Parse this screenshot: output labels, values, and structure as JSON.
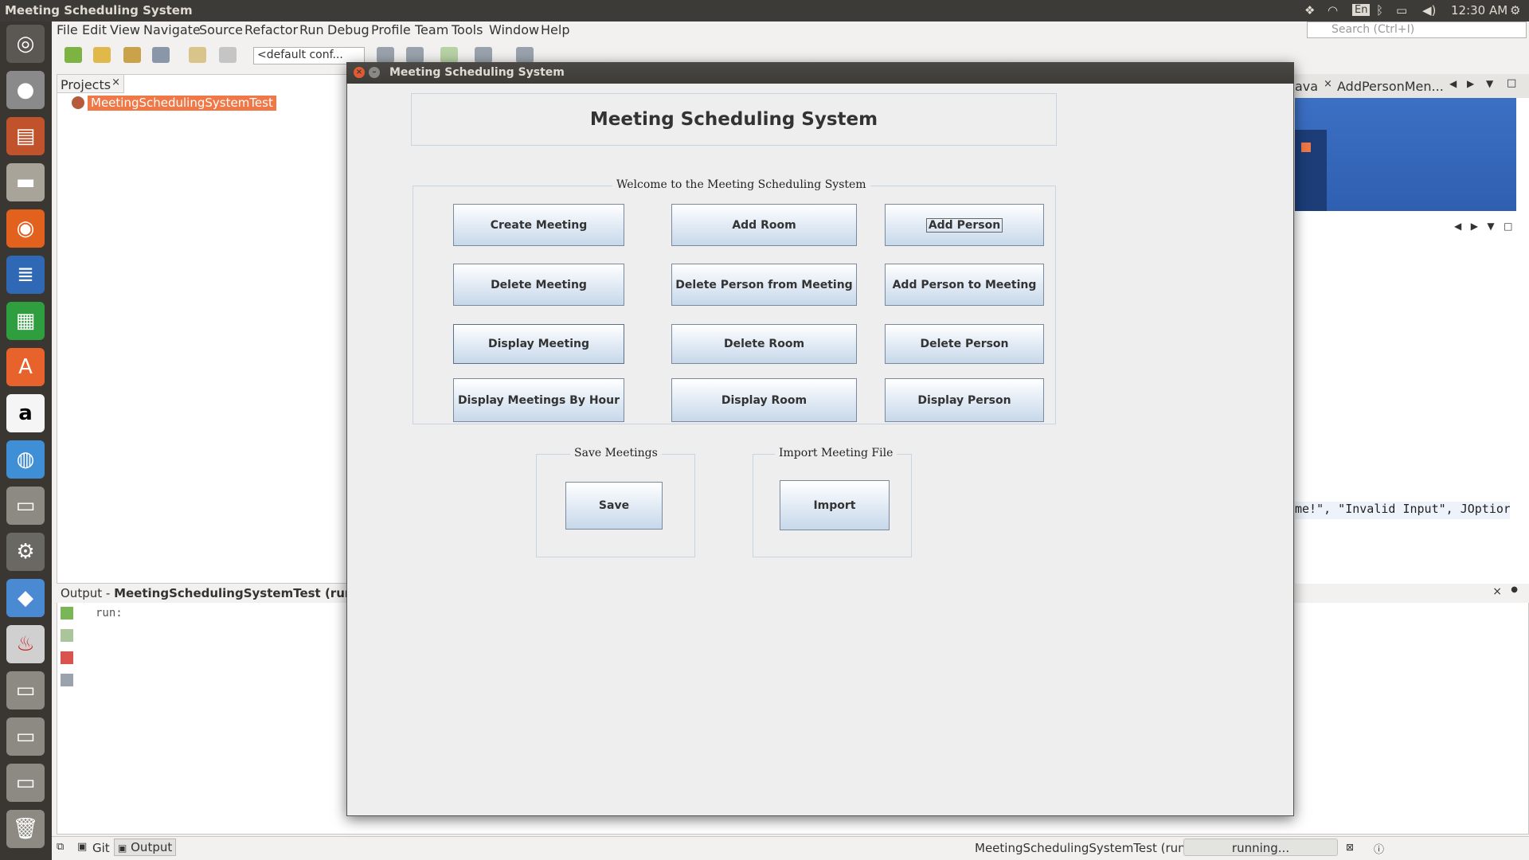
{
  "system": {
    "window_title": "Meeting Scheduling System",
    "lang": "En",
    "time": "12:30 AM"
  },
  "ide": {
    "menu": [
      "File",
      "Edit",
      "View",
      "Navigate",
      "Source",
      "Refactor",
      "Run",
      "Debug",
      "Profile",
      "Team",
      "Tools",
      "Window",
      "Help"
    ],
    "config": "<default conf...",
    "search_placeholder": "Search (Ctrl+I)",
    "projects_tab": "Projects",
    "project_name": "MeetingSchedulingSystemTest",
    "editor_tabs": [
      "ava",
      "AddPersonMen..."
    ],
    "code_snippet": "me!\", \"Invalid Input\", JOptior",
    "output_label": "Output - ",
    "output_target": "MeetingSchedulingSystemTest (run)",
    "output_text": "run:",
    "status_tabs": [
      "Git",
      "Output"
    ],
    "status_run_label": "MeetingSchedulingSystemTest (run)",
    "status_progress": "running..."
  },
  "dialog": {
    "title": "Meeting Scheduling System",
    "heading": "Meeting Scheduling System",
    "welcome_legend": "Welcome to the Meeting Scheduling System",
    "buttons": {
      "create_meeting": "Create Meeting",
      "add_room": "Add Room",
      "add_person": "Add Person",
      "delete_meeting": "Delete Meeting",
      "delete_person_from_meeting": "Delete Person from Meeting",
      "add_person_to_meeting": "Add Person to Meeting",
      "display_meeting": "Display Meeting",
      "delete_room": "Delete Room",
      "delete_person": "Delete Person",
      "display_meetings_by_hour": "Display Meetings By Hour",
      "display_room": "Display Room",
      "display_person": "Display Person"
    },
    "save_legend": "Save Meetings",
    "save_button": "Save",
    "import_legend": "Import Meeting File",
    "import_button": "Import"
  }
}
